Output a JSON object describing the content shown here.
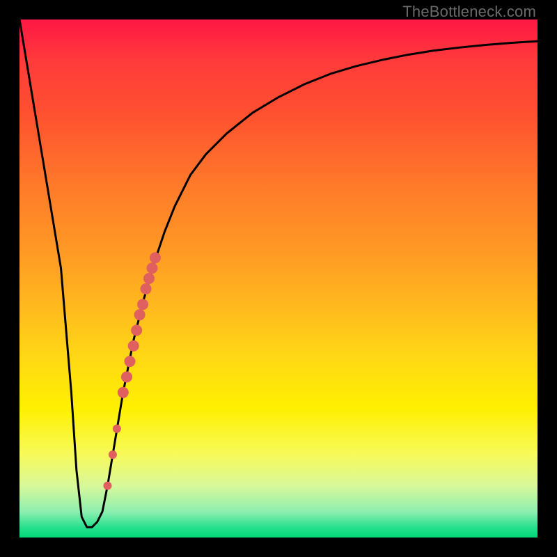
{
  "attribution": "TheBottleneck.com",
  "colors": {
    "frame": "#000000",
    "curve": "#000000",
    "marker_fill": "#e06060",
    "marker_stroke": "#c94f4f"
  },
  "chart_data": {
    "type": "line",
    "title": "",
    "xlabel": "",
    "ylabel": "",
    "xlim": [
      0,
      100
    ],
    "ylim": [
      0,
      100
    ],
    "grid": false,
    "series": [
      {
        "name": "bottleneck-curve",
        "x": [
          0,
          2,
          4,
          6,
          8,
          10,
          11,
          12,
          13,
          13.5,
          14,
          15,
          16,
          17,
          18,
          19,
          20,
          22,
          24,
          26,
          28,
          30,
          33,
          36,
          40,
          45,
          50,
          55,
          60,
          65,
          70,
          75,
          80,
          85,
          90,
          95,
          100
        ],
        "y": [
          100,
          88,
          76,
          64,
          52,
          28,
          13,
          4,
          2,
          2,
          2,
          3,
          5,
          10,
          16,
          22,
          28,
          38,
          46,
          53,
          59,
          64,
          70,
          74,
          78,
          82,
          85,
          87.5,
          89.5,
          91,
          92.2,
          93.2,
          94,
          94.6,
          95.1,
          95.5,
          95.8
        ]
      }
    ],
    "markers": {
      "name": "highlighted-points",
      "points": [
        {
          "x": 17.0,
          "y": 10,
          "r": 6
        },
        {
          "x": 18.0,
          "y": 16,
          "r": 6
        },
        {
          "x": 18.8,
          "y": 21,
          "r": 6
        },
        {
          "x": 20.0,
          "y": 28,
          "r": 8
        },
        {
          "x": 20.7,
          "y": 31,
          "r": 8
        },
        {
          "x": 21.3,
          "y": 34,
          "r": 8
        },
        {
          "x": 22.0,
          "y": 37,
          "r": 8
        },
        {
          "x": 22.6,
          "y": 40,
          "r": 8
        },
        {
          "x": 23.2,
          "y": 43,
          "r": 8
        },
        {
          "x": 23.8,
          "y": 45,
          "r": 8
        },
        {
          "x": 24.4,
          "y": 48,
          "r": 8
        },
        {
          "x": 25.0,
          "y": 50,
          "r": 8
        },
        {
          "x": 25.6,
          "y": 52,
          "r": 8
        },
        {
          "x": 26.2,
          "y": 54,
          "r": 8
        }
      ]
    }
  }
}
